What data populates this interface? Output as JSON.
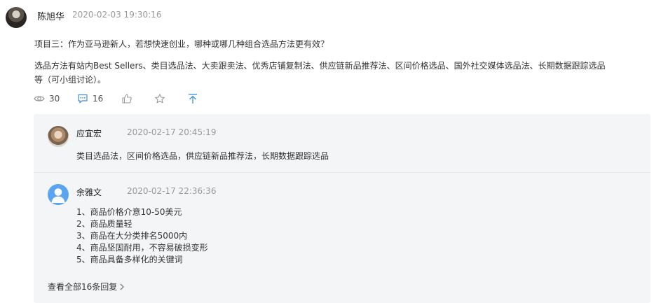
{
  "post": {
    "author": "陈旭华",
    "time": "2020-02-03 19:30:16",
    "question": "项目三：作为亚马逊新人，若想快速创业，哪种或哪几种组合选品方法更有效？",
    "methods": "选品方法有站内Best Sellers、类目选品法、大卖跟卖法、优秀店铺复制法、供应链新品推荐法、区间价格选品、国外社交媒体选品法、长期数据跟踪选品等（可小组讨论）。",
    "views": "30",
    "comments": "16"
  },
  "icons": {
    "views": "eye-icon",
    "comments": "comment-icon",
    "like": "thumbs-up-icon",
    "favorite": "star-icon",
    "top": "arrow-up-icon",
    "accent": "#3d8fe0"
  },
  "replies": [
    {
      "author": "应宜宏",
      "time": "2020-02-17 20:45:19",
      "content": "类目选品法，区间价格选品，供应链新品推荐法，长期数据跟踪选品"
    },
    {
      "author": "余雅文",
      "time": "2020-02-17 22:36:36",
      "lines": [
        "1、商品价格介意10-50美元",
        "2、商品质量轻",
        "3、商品在大分类排名5000内",
        "4、商品坚固耐用，不容易破损变形",
        "5、商品具备多样化的关键词"
      ]
    }
  ],
  "view_all": "查看全部16条回复"
}
